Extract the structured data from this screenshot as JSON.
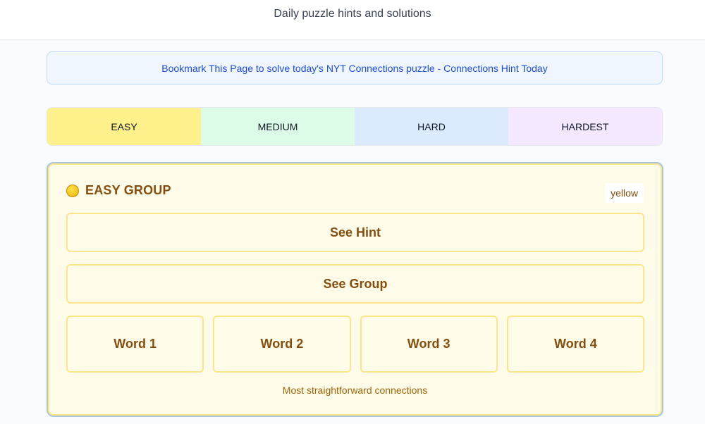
{
  "header": {
    "subtitle": "Daily puzzle hints and solutions"
  },
  "banner": {
    "text": "Bookmark This Page to solve today's NYT Connections puzzle - Connections Hint Today"
  },
  "tabs": [
    {
      "label": "EASY",
      "color": "#fef08a"
    },
    {
      "label": "MEDIUM",
      "color": "#dcfce7"
    },
    {
      "label": "HARD",
      "color": "#dbeafe"
    },
    {
      "label": "HARDEST",
      "color": "#f3e8ff"
    }
  ],
  "group": {
    "icon": "yellow-circle-icon",
    "title": "EASY GROUP",
    "color_label": "yellow",
    "hint_button": "See Hint",
    "group_button": "See Group",
    "words": [
      "Word 1",
      "Word 2",
      "Word 3",
      "Word 4"
    ],
    "description": "Most straightforward connections",
    "accent": "#854d0e"
  }
}
